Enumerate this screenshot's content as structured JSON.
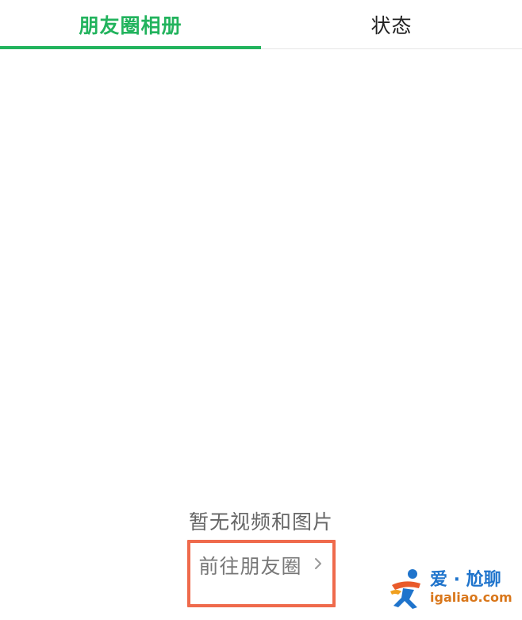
{
  "tabs": [
    {
      "label": "朋友圈相册",
      "active": true
    },
    {
      "label": "状态",
      "active": false
    }
  ],
  "colors": {
    "accent": "#22b35d",
    "highlight_box": "#ef6a4c",
    "watermark_blue": "#1f74cc",
    "watermark_orange": "#d9771b"
  },
  "empty_state": {
    "message": "暂无视频和图片",
    "link_label": "前往朋友圈",
    "link_icon": "chevron-right-icon"
  },
  "watermark": {
    "logo": "igaliao-logo",
    "title": "爱 · 尬聊",
    "url": "igaliao.com"
  }
}
